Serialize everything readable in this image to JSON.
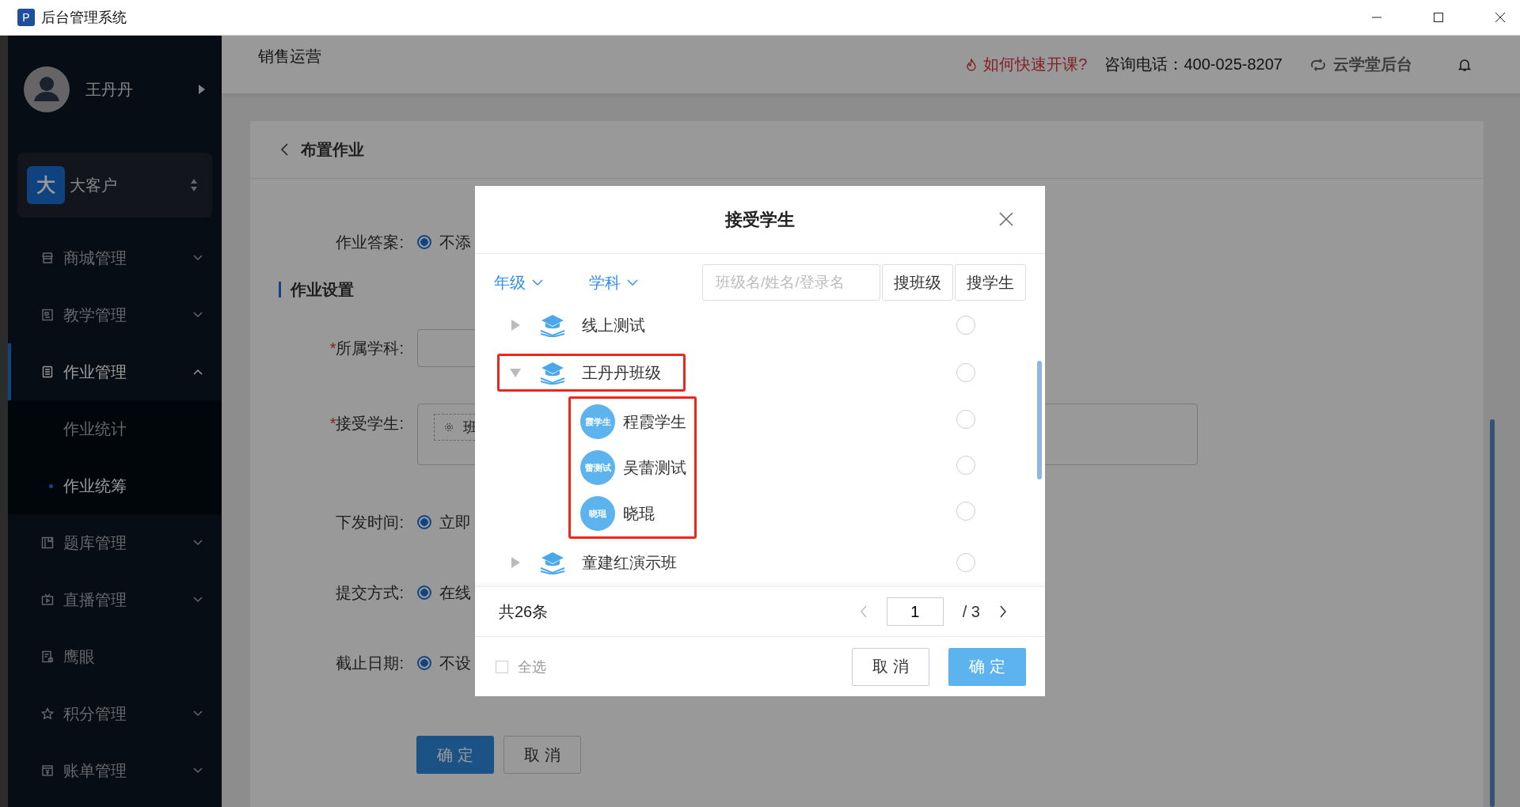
{
  "window": {
    "title": "后台管理系统",
    "app_icon": "P"
  },
  "sidebar": {
    "user": {
      "name": "王丹丹"
    },
    "account": {
      "badge": "大",
      "name": "大客户"
    },
    "items": [
      {
        "label": "商城管理",
        "expanded": false,
        "selected": false
      },
      {
        "label": "教学管理",
        "expanded": false,
        "selected": false
      },
      {
        "label": "作业管理",
        "expanded": true,
        "selected": true,
        "children": [
          {
            "label": "作业统计",
            "selected": false
          },
          {
            "label": "作业统筹",
            "selected": true
          }
        ]
      },
      {
        "label": "题库管理",
        "expanded": false,
        "selected": false
      },
      {
        "label": "直播管理",
        "expanded": false,
        "selected": false
      },
      {
        "label": "鹰眼",
        "selected": false
      },
      {
        "label": "积分管理",
        "expanded": false,
        "selected": false
      },
      {
        "label": "账单管理",
        "expanded": false,
        "selected": false
      }
    ]
  },
  "header": {
    "title": "销售运营",
    "help_link": "如何快速开课?",
    "phone": "咨询电话：400-025-8207",
    "brand": "云学堂后台"
  },
  "page": {
    "back_title": "布置作业",
    "fields": [
      {
        "kind": "radio",
        "label": "作业答案:",
        "value": "不添",
        "checked": true
      },
      {
        "kind": "section",
        "label": "作业设置"
      },
      {
        "kind": "select",
        "label": "所属学科:",
        "required_mark": "*"
      },
      {
        "kind": "tags",
        "label": "接受学生:",
        "required_mark": "*",
        "tag": "班"
      },
      {
        "kind": "radio",
        "label": "下发时间:",
        "value": "立即",
        "checked": true
      },
      {
        "kind": "radio",
        "label": "提交方式:",
        "value": "在线",
        "checked": true
      },
      {
        "kind": "radio",
        "label": "截止日期:",
        "value": "不设",
        "checked": true
      }
    ],
    "buttons": [
      {
        "label": "确 定",
        "primary": true
      },
      {
        "label": "取 消",
        "primary": false
      }
    ]
  },
  "dialog": {
    "title": "接受学生",
    "filters": [
      "年级",
      "学科"
    ],
    "search": {
      "placeholder": "班级名/姓名/登录名"
    },
    "search_buttons": [
      "搜班级",
      "搜学生"
    ],
    "tree": [
      {
        "name": "线上测试",
        "expanded": false,
        "selected": false,
        "highlighted": false
      },
      {
        "name": "王丹丹班级",
        "expanded": true,
        "selected": false,
        "highlighted": true,
        "children_highlighted": true,
        "children": [
          {
            "name": "程霞学生",
            "avatar": "霞学生",
            "selected": false
          },
          {
            "name": "吴蕾测试",
            "avatar": "蕾测试",
            "selected": false
          },
          {
            "name": "晓琨",
            "avatar": "晓琨",
            "selected": false
          }
        ]
      },
      {
        "name": "童建红演示班",
        "expanded": false,
        "selected": false,
        "highlighted": false
      }
    ],
    "total": "共26条",
    "page": "1",
    "pages": "/ 3",
    "prev_disabled": true,
    "select_all": {
      "label": "全选",
      "checked": false
    },
    "buttons": [
      {
        "label": "取 消",
        "primary": false
      },
      {
        "label": "确 定",
        "primary": true
      }
    ]
  }
}
